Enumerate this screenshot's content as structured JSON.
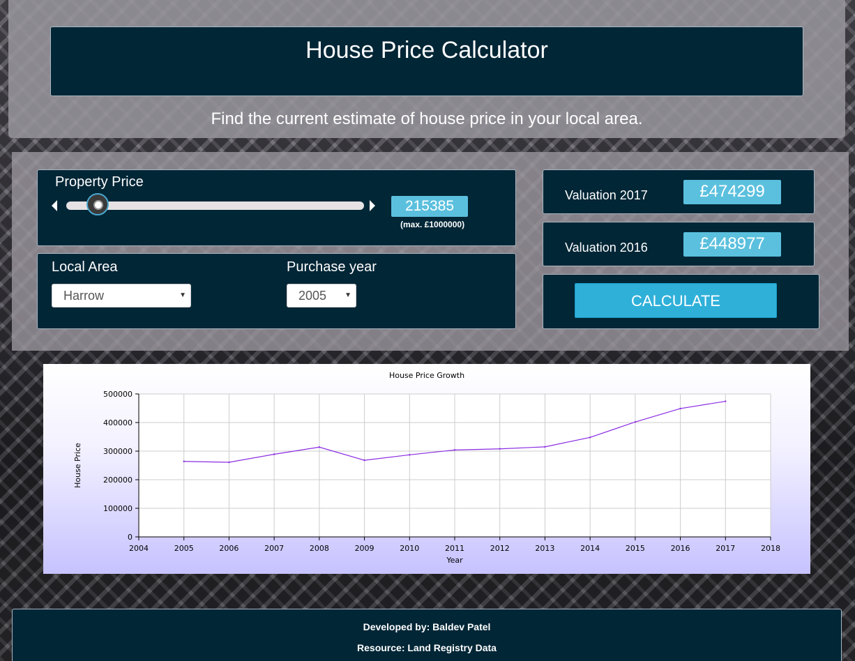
{
  "header": {
    "title": "House Price Calculator",
    "subtitle": "Find the current estimate of house price in your local area."
  },
  "property_price": {
    "label": "Property Price",
    "value": "215385",
    "max_note": "(max. £1000000)",
    "slider_fraction": 0.215385
  },
  "local_area": {
    "label": "Local Area",
    "selected": "Harrow"
  },
  "purchase_year": {
    "label": "Purchase year",
    "selected": "2005"
  },
  "valuations": [
    {
      "label": "Valuation 2017",
      "amount": "£474299"
    },
    {
      "label": "Valuation 2016",
      "amount": "£448977"
    }
  ],
  "calculate_label": "CALCULATE",
  "chart_data": {
    "type": "line",
    "title": "House Price Growth",
    "xlabel": "Year",
    "ylabel": "House Price",
    "xlim": [
      2004,
      2018
    ],
    "ylim": [
      0,
      500000
    ],
    "xticks": [
      2004,
      2005,
      2006,
      2007,
      2008,
      2009,
      2010,
      2011,
      2012,
      2013,
      2014,
      2015,
      2016,
      2017,
      2018
    ],
    "yticks": [
      0,
      100000,
      200000,
      300000,
      400000,
      500000
    ],
    "grid": true,
    "series": [
      {
        "color": "#8a2be2",
        "x": [
          2005,
          2006,
          2007,
          2008,
          2009,
          2010,
          2011,
          2012,
          2013,
          2014,
          2015,
          2016,
          2017
        ],
        "y": [
          264000,
          261000,
          289000,
          314000,
          268000,
          287000,
          304000,
          308000,
          315000,
          348000,
          402000,
          448977,
          474299
        ]
      }
    ]
  },
  "footer": {
    "developer": "Developed by: Baldev Patel",
    "resource": "Resource: Land Registry Data"
  }
}
